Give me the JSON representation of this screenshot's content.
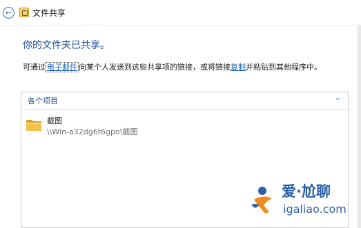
{
  "titlebar": {
    "title": "文件共享",
    "back_icon": "back-arrow-icon",
    "app_icon": "file-sharing-icon"
  },
  "main": {
    "heading": "你的文件夹已共享。",
    "desc_before": "可通过",
    "email_link": "电子邮件",
    "desc_middle": "向某个人发送到这些共享项的链接，或将链接",
    "copy_link": "复制",
    "desc_after": "并粘贴到其他程序中。"
  },
  "panel": {
    "title": "各个项目",
    "collapse_icon": "chevron-up-icon",
    "items": [
      {
        "name": "截图",
        "path": "\\\\Win-a32dg6t6gpo\\截图",
        "icon": "folder-icon"
      }
    ]
  },
  "watermark": {
    "brand": "爱·尬聊",
    "url": "igaliao.com"
  },
  "colors": {
    "accent": "#1e4f9a",
    "link": "#1a5fb4",
    "folder": "#e8b43c",
    "watermark_blue": "#2b5fa8",
    "watermark_orange": "#f28a1d"
  }
}
